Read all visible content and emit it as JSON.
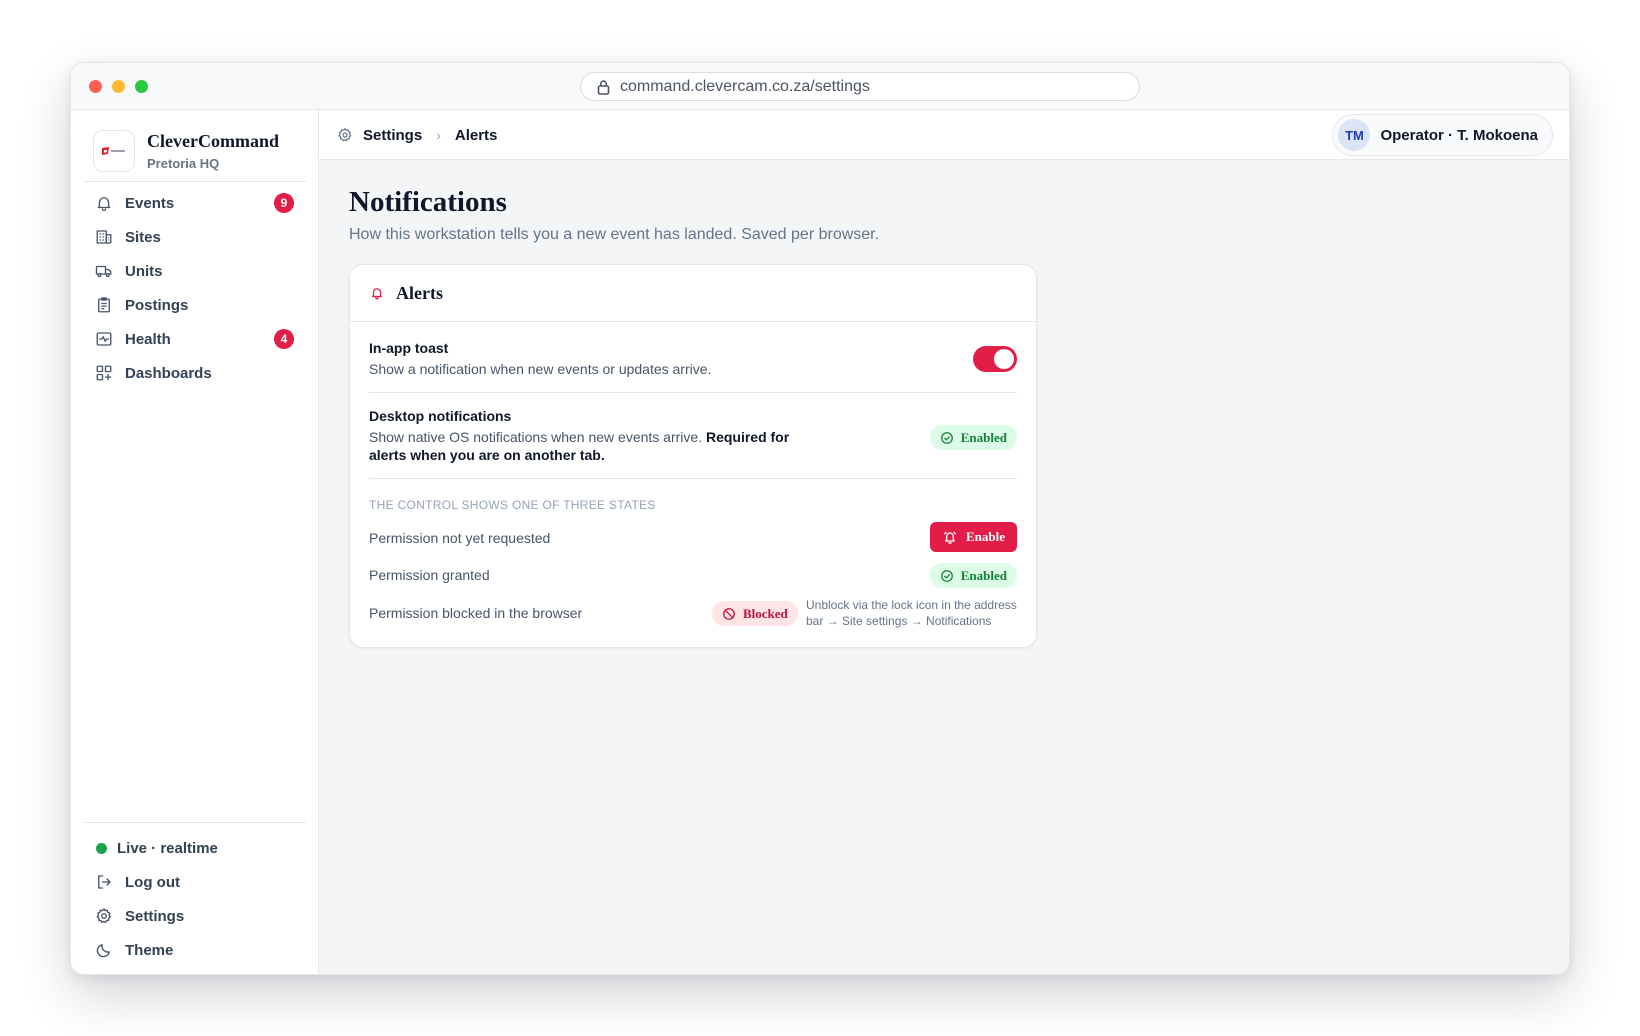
{
  "browser": {
    "url": "command.clevercam.co.za/settings"
  },
  "sidebar": {
    "brand_name": "CleverCommand",
    "brand_sub": "Pretoria HQ",
    "items": [
      {
        "label": "Events",
        "icon": "bell-icon",
        "badge": "9"
      },
      {
        "label": "Sites",
        "icon": "building-icon",
        "badge": ""
      },
      {
        "label": "Units",
        "icon": "truck-icon",
        "badge": ""
      },
      {
        "label": "Postings",
        "icon": "clipboard-icon",
        "badge": ""
      },
      {
        "label": "Health",
        "icon": "pulse-icon",
        "badge": "4"
      },
      {
        "label": "Dashboards",
        "icon": "dashboard-grid-icon",
        "badge": ""
      }
    ],
    "footer": {
      "live": "Live · realtime",
      "logout": "Log out",
      "settings": "Settings",
      "theme": "Theme"
    }
  },
  "topbar": {
    "crumb_root": "Settings",
    "crumb_current": "Alerts",
    "avatar_initials": "TM",
    "operator": "Operator · T. Mokoena"
  },
  "page": {
    "title": "Notifications",
    "subtitle": "How this workstation tells you a new event has landed. Saved per browser."
  },
  "card": {
    "title": "Alerts",
    "toast": {
      "title": "In-app toast",
      "desc": "Show a notification when new events or updates arrive.",
      "enabled": true
    },
    "desktop": {
      "title": "Desktop notifications",
      "desc": "Show native OS notifications when new events arrive.",
      "desc_bold": "Required for alerts when you are on another tab.",
      "status": "Enabled"
    },
    "states_label": "THE CONTROL SHOWS ONE OF THREE STATES",
    "states": {
      "not_requested": "Permission not yet requested",
      "enable_btn": "Enable",
      "granted": "Permission granted",
      "granted_status": "Enabled",
      "blocked": "Permission blocked in the browser",
      "blocked_status": "Blocked",
      "blocked_hint": "Unblock via the lock icon in the address bar → Site settings → Notifications"
    }
  },
  "colors": {
    "accent": "#e11d48",
    "success": "#15803d",
    "live": "#16a34a"
  }
}
